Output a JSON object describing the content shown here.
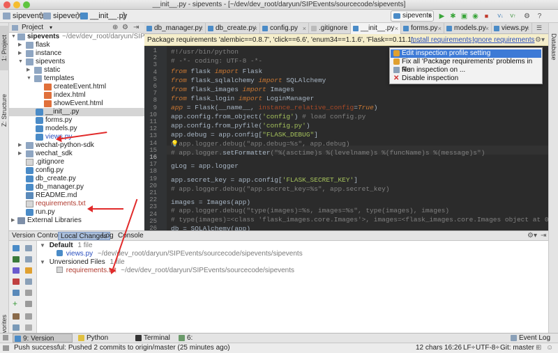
{
  "window": {
    "title": "__init__.py - sipevents - [~/dev/dev_root/daryun/SIPEvents/sourcecode/sipevents]"
  },
  "breadcrumb": [
    "sipevents",
    "sipevents",
    "__init__.py"
  ],
  "toolbar": {
    "run_config": "sipevents"
  },
  "left_strip": {
    "project_tab": "1: Project",
    "structure_tab": "Z: Structure",
    "favorites_tab": "2: Favorites"
  },
  "right_strip": {
    "database_tab": "Database"
  },
  "project_panel": {
    "header": "Project",
    "root": "sipevents",
    "root_path": "~/dev/dev_root/daryun/SIPE",
    "items": [
      {
        "label": "flask",
        "kind": "folder"
      },
      {
        "label": "instance",
        "kind": "folder"
      },
      {
        "label": "sipevents",
        "kind": "folder"
      },
      {
        "label": "static",
        "kind": "folder"
      },
      {
        "label": "templates",
        "kind": "folder"
      },
      {
        "label": "createEvent.html",
        "kind": "html"
      },
      {
        "label": "index.html",
        "kind": "html"
      },
      {
        "label": "showEvent.html",
        "kind": "html"
      },
      {
        "label": "__init__.py",
        "kind": "py"
      },
      {
        "label": "forms.py",
        "kind": "py"
      },
      {
        "label": "models.py",
        "kind": "py"
      },
      {
        "label": "views.py",
        "kind": "py"
      },
      {
        "label": "wechat-python-sdk",
        "kind": "folder"
      },
      {
        "label": "wechat_sdk",
        "kind": "folder"
      },
      {
        "label": ".gitignore",
        "kind": "txt"
      },
      {
        "label": "config.py",
        "kind": "py"
      },
      {
        "label": "db_create.py",
        "kind": "py"
      },
      {
        "label": "db_manager.py",
        "kind": "py"
      },
      {
        "label": "README.md",
        "kind": "md"
      },
      {
        "label": "requirements.txt",
        "kind": "txt"
      },
      {
        "label": "run.py",
        "kind": "py"
      },
      {
        "label": "External Libraries",
        "kind": "lib"
      }
    ]
  },
  "editor_tabs": [
    "db_manager.py",
    "db_create.py",
    "config.py",
    ".gitignore",
    "__init__.py",
    "forms.py",
    "models.py",
    "views.py"
  ],
  "banner": {
    "text": "Package requirements 'alembic==0.8.7', 'click==6.6', 'enum34==1.1.6', 'Flask==0.11.1',...",
    "install_link": "Install requirements",
    "ignore_link": "Ignore requirements"
  },
  "popup": {
    "items": [
      "Edit inspection profile setting",
      "Fix all 'Package requirements' problems in file",
      "Run inspection on ...",
      "Disable inspection"
    ]
  },
  "code": {
    "line_numbers": [
      "1",
      "2",
      "3",
      "4",
      "5",
      "6",
      "7",
      "8",
      "9",
      "10",
      "11",
      "12",
      "13",
      "14",
      "15",
      "16",
      "17",
      "18",
      "19",
      "20",
      "21",
      "22",
      "23",
      "24",
      "25",
      "26"
    ]
  },
  "version_control": {
    "label": "Version Control:",
    "tabs": [
      "Local Changes",
      "Log",
      "Console"
    ],
    "default_group": "Default",
    "default_count": "1 file",
    "default_file": "views.py",
    "default_path": "~/dev/dev_root/daryun/SIPEvents/sourcecode/sipevents/sipevents",
    "unversioned_group": "Unversioned Files",
    "unversioned_count": "1 file",
    "unversioned_file": "requirements.txt",
    "unversioned_path": "~/dev/dev_root/daryun/SIPEvents/sourcecode/sipevents"
  },
  "bottom_tabs": [
    "9: Version Control",
    "Python Console",
    "Terminal",
    "6: TODO"
  ],
  "event_log": "Event Log",
  "status": {
    "message": "Push successful: Pushed 2 commits to origin/master (25 minutes ago)",
    "chars": "12 chars",
    "position": "16:26",
    "line_sep": "LF÷",
    "encoding": "UTF-8÷",
    "git": "Git: master ÷"
  },
  "colors": {
    "accent": "#3d7ad6",
    "arrow": "#e12a2a",
    "editor_bg": "#2b2b2b",
    "banner_bg": "#f5eecb"
  }
}
